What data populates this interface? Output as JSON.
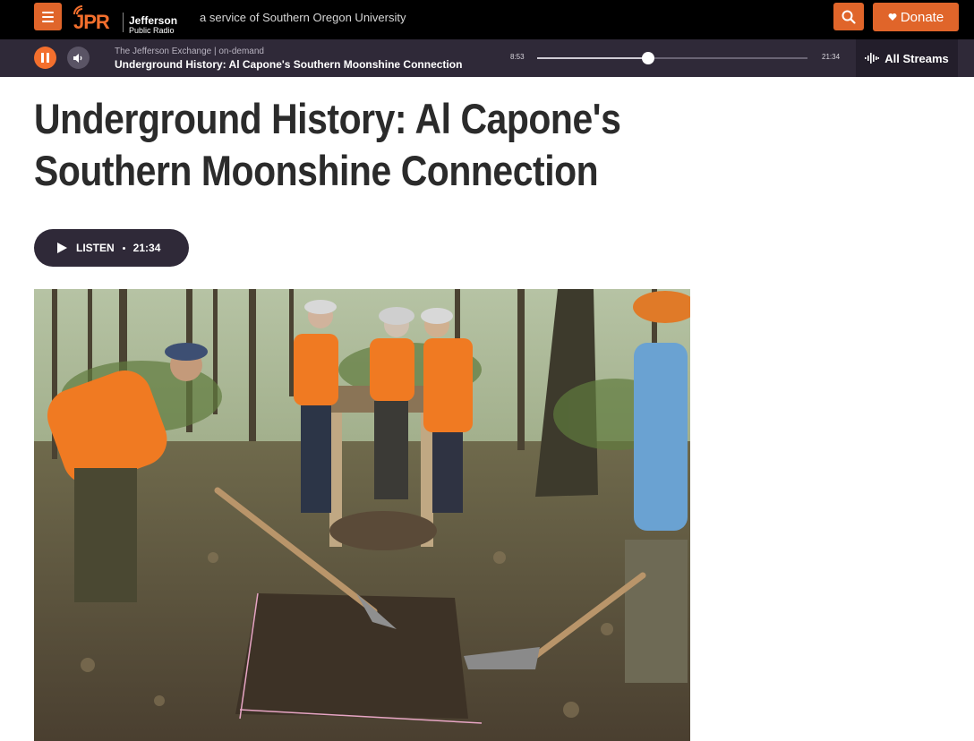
{
  "header": {
    "logo_mark": "JPR",
    "logo_line1": "Jefferson",
    "logo_line2": "Public Radio",
    "tagline": "a service of Southern Oregon University",
    "donate_label": "Donate",
    "icons": {
      "menu": "hamburger-icon",
      "search": "search-icon",
      "donate": "heart-icon"
    },
    "accent_color": "#e0652a"
  },
  "player": {
    "show_label": "The Jefferson Exchange | on-demand",
    "episode_title": "Underground History: Al Capone's Southern Moonshine Connection",
    "time_elapsed": "8:53",
    "time_total": "21:34",
    "progress_fraction": 0.41,
    "streams_label": "All Streams",
    "icons": {
      "pause": "pause-icon",
      "volume": "volume-icon",
      "streams": "audio-wave-icon"
    },
    "background_color": "#2f2938"
  },
  "article": {
    "headline_line1": "Underground History: Al Capone's",
    "headline_line2": "Southern Moonshine Connection",
    "listen_label": "LISTEN",
    "listen_duration": "21:34"
  }
}
